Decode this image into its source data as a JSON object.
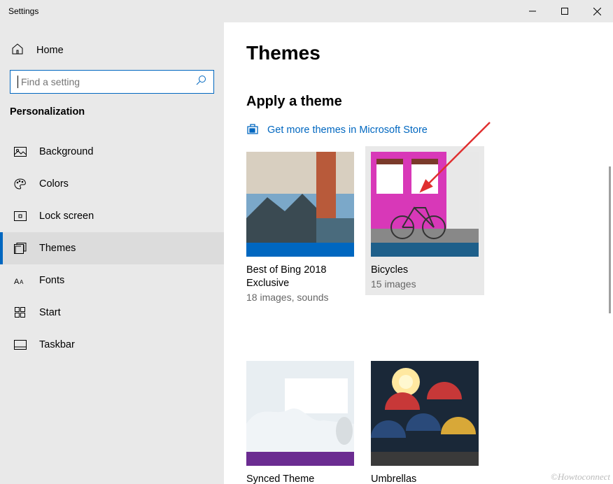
{
  "window": {
    "title": "Settings"
  },
  "sidebar": {
    "home": "Home",
    "search_placeholder": "Find a setting",
    "section": "Personalization",
    "items": [
      {
        "label": "Background"
      },
      {
        "label": "Colors"
      },
      {
        "label": "Lock screen"
      },
      {
        "label": "Themes"
      },
      {
        "label": "Fonts"
      },
      {
        "label": "Start"
      },
      {
        "label": "Taskbar"
      }
    ]
  },
  "page": {
    "title": "Themes",
    "section_title": "Apply a theme",
    "store_link": "Get more themes in Microsoft Store"
  },
  "themes": [
    {
      "name": "Best of Bing 2018 Exclusive",
      "meta": "18 images, sounds",
      "strip": "#0067c0"
    },
    {
      "name": "Bicycles",
      "meta": "15 images",
      "strip": "#1e5f8a"
    },
    {
      "name": "Synced Theme",
      "meta": "",
      "strip": "#6b2c91"
    },
    {
      "name": "Umbrellas",
      "meta": "",
      "strip": "#3a3a3a"
    }
  ],
  "watermark": "©Howtoconnect"
}
